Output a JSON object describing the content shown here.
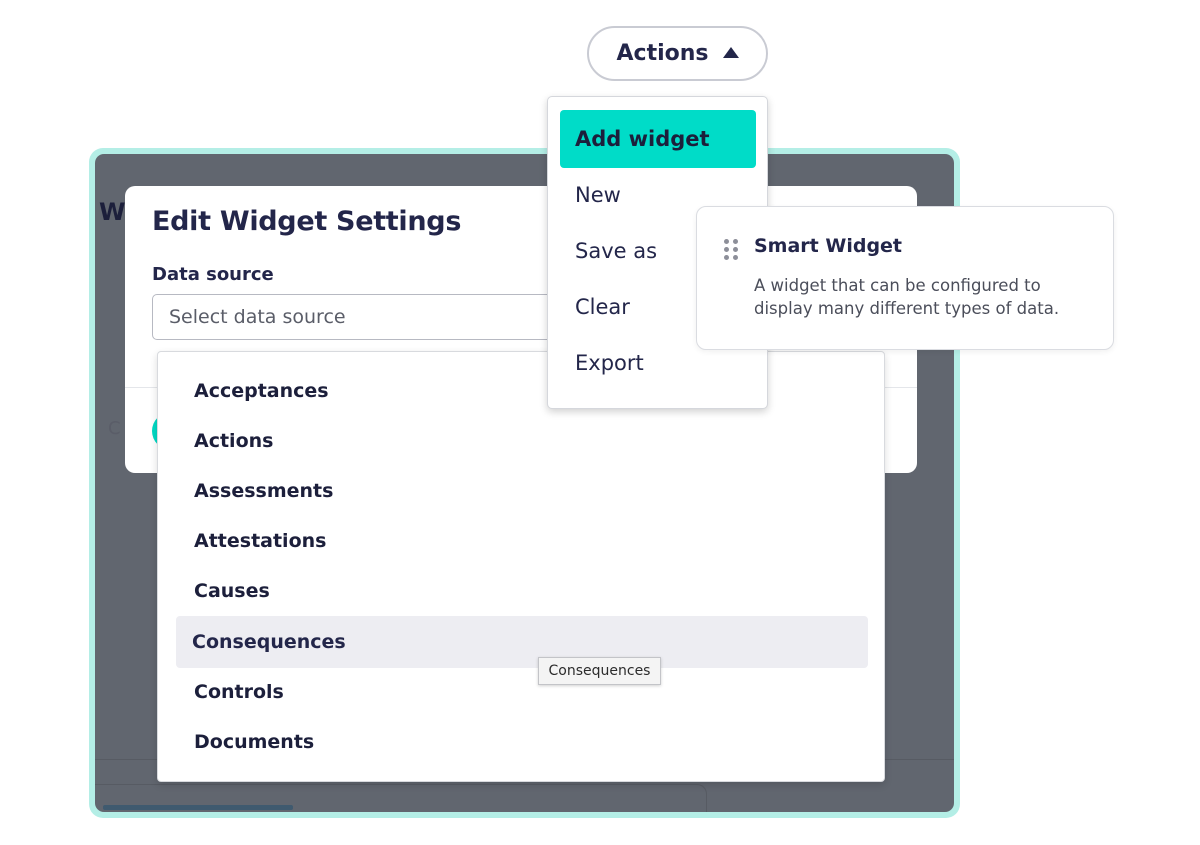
{
  "actions_button": {
    "label": "Actions"
  },
  "actions_menu": {
    "items": [
      {
        "label": "Add widget",
        "active": true
      },
      {
        "label": "New"
      },
      {
        "label": "Save as"
      },
      {
        "label": "Clear"
      },
      {
        "label": "Export"
      }
    ]
  },
  "background": {
    "title_fragment": "Wi",
    "footer_fragment": "C"
  },
  "modal": {
    "title": "Edit Widget Settings",
    "data_source_label": "Data source",
    "data_source_placeholder": "Select data source"
  },
  "data_source_options": [
    "Acceptances",
    "Actions",
    "Assessments",
    "Attestations",
    "Causes",
    "Consequences",
    "Controls",
    "Documents"
  ],
  "hovered_option": "Consequences",
  "tooltip": {
    "text": "Consequences"
  },
  "widget_card": {
    "title": "Smart Widget",
    "description": "A widget that can be configured to display many different types of data."
  },
  "colors": {
    "accent": "#00dcc8",
    "frame_glow": "#b4eee6",
    "overlay": "#61666f",
    "text_dark": "#23264a",
    "hover_row": "#ededf2"
  }
}
